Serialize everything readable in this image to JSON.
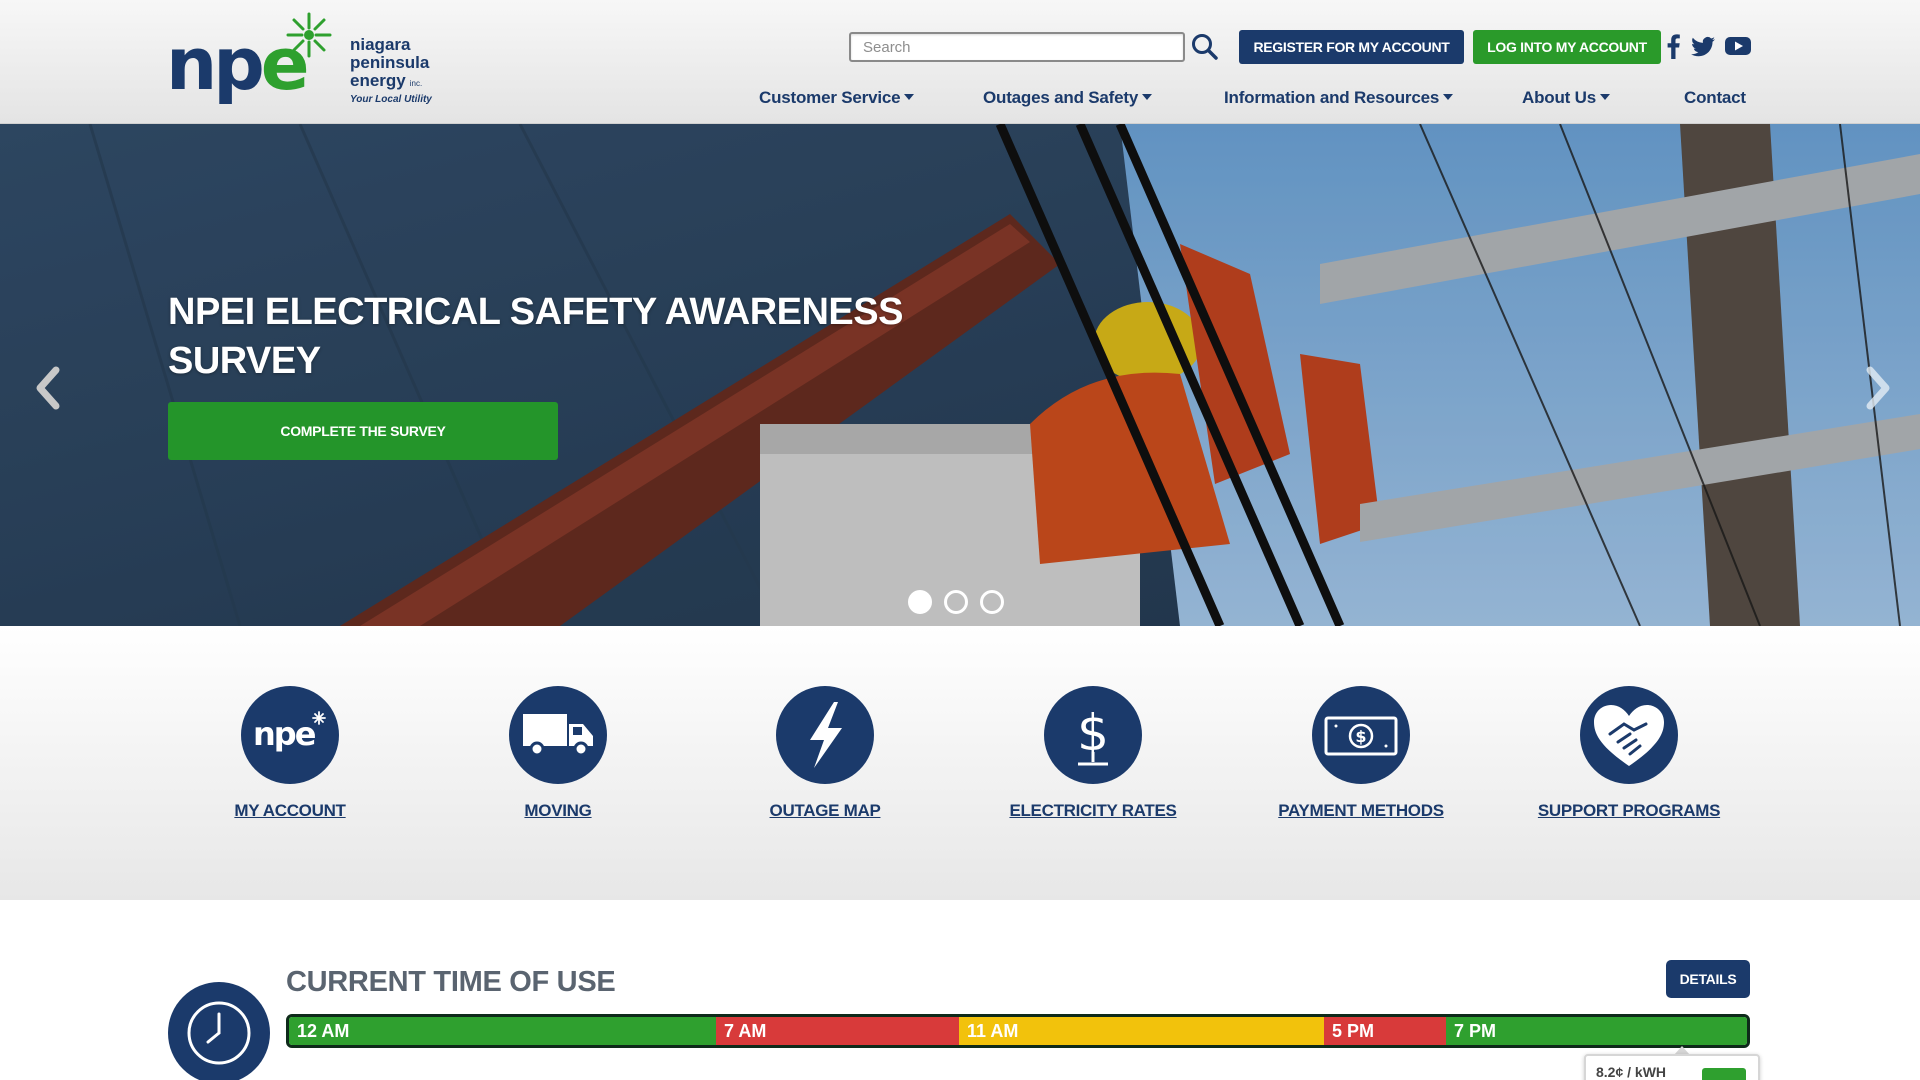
{
  "brand": {
    "logo_mark_np": "np",
    "logo_mark_e": "e",
    "logo_line1": "niagara",
    "logo_line2": "peninsula",
    "logo_line3": "energy",
    "logo_inc": "inc.",
    "logo_tagline": "Your Local Utility",
    "primary_color": "#1b3a6b",
    "accent_color": "#2a9a2a"
  },
  "header": {
    "search_placeholder": "Search",
    "search_icon": "search-icon",
    "register_label": "REGISTER FOR MY ACCOUNT",
    "login_label": "LOG INTO MY ACCOUNT",
    "social_icons": [
      "facebook-icon",
      "twitter-icon",
      "youtube-icon"
    ]
  },
  "nav": {
    "items": [
      {
        "label": "Customer Service",
        "dropdown": true
      },
      {
        "label": "Outages and Safety",
        "dropdown": true
      },
      {
        "label": "Information and Resources",
        "dropdown": true
      },
      {
        "label": "About Us",
        "dropdown": true
      },
      {
        "label": "Contact",
        "dropdown": false
      }
    ]
  },
  "hero": {
    "title": "NPEI ELECTRICAL SAFETY AWARENESS SURVEY",
    "cta_label": "COMPLETE THE SURVEY",
    "slide_count": 3,
    "active_slide": 1
  },
  "quick_links": [
    {
      "label": "MY ACCOUNT",
      "icon": "npe-logo-icon"
    },
    {
      "label": "MOVING",
      "icon": "truck-icon"
    },
    {
      "label": "OUTAGE MAP",
      "icon": "lightning-icon"
    },
    {
      "label": "ELECTRICITY RATES",
      "icon": "dollar-icon"
    },
    {
      "label": "PAYMENT METHODS",
      "icon": "banknote-icon"
    },
    {
      "label": "SUPPORT PROGRAMS",
      "icon": "heart-handshake-icon"
    }
  ],
  "time_of_use": {
    "title": "CURRENT TIME OF USE",
    "details_label": "DETAILS",
    "segments": [
      {
        "label": "12 AM",
        "level": "off-peak",
        "color": "#2fa02f"
      },
      {
        "label": "7 AM",
        "level": "on-peak",
        "color": "#d83a3a"
      },
      {
        "label": "11 AM",
        "level": "mid-peak",
        "color": "#f2c20c"
      },
      {
        "label": "5 PM",
        "level": "on-peak",
        "color": "#d83a3a"
      },
      {
        "label": "7 PM",
        "level": "off-peak",
        "color": "#2fa02f"
      }
    ],
    "current_price": "8.2¢ / kWH"
  }
}
